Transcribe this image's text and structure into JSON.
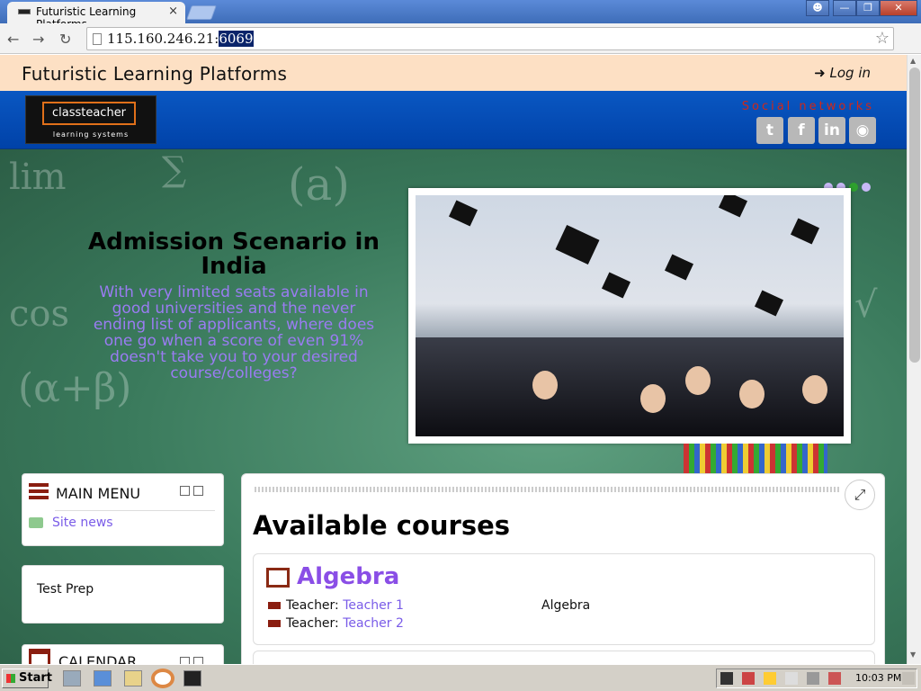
{
  "browser": {
    "tab_title": "Futuristic Learning Platforms",
    "tab_close": "×",
    "url_prefix": "115.160.246.21:",
    "url_selected": "6069"
  },
  "site": {
    "name": "Futuristic Learning Platforms",
    "login": "Log in",
    "logo_text": "classteacher",
    "logo_sub": "learning systems",
    "social_title": "Social networks",
    "social": [
      "twitter",
      "facebook",
      "linkedin",
      "website"
    ]
  },
  "slider": {
    "title": "Admission Scenario in India",
    "text": "With very limited seats available in good universities and the never ending list of applicants, where does one go when a score of even 91% doesn't take you to your desired course/colleges?",
    "dots": 4,
    "active_dot": 3
  },
  "main_menu": {
    "title": "MAIN MENU",
    "items": [
      {
        "label": "Site news",
        "icon": "news-icon"
      }
    ]
  },
  "test_prep": {
    "label": "Test Prep"
  },
  "calendar": {
    "title": "CALENDAR"
  },
  "courses": {
    "heading": "Available courses",
    "list": [
      {
        "name": "Algebra",
        "teacher_label": "Teacher:",
        "teachers": [
          "Teacher 1",
          "Teacher 2"
        ],
        "summary": "Algebra"
      }
    ]
  },
  "taskbar": {
    "start": "Start",
    "clock": "10:03 PM"
  },
  "colors": {
    "topbar": "#fde0c4",
    "header": "#0a57c2",
    "accent_link": "#7a5ce8",
    "course_title": "#8a4ee6",
    "icon_red": "#8a1e10"
  }
}
